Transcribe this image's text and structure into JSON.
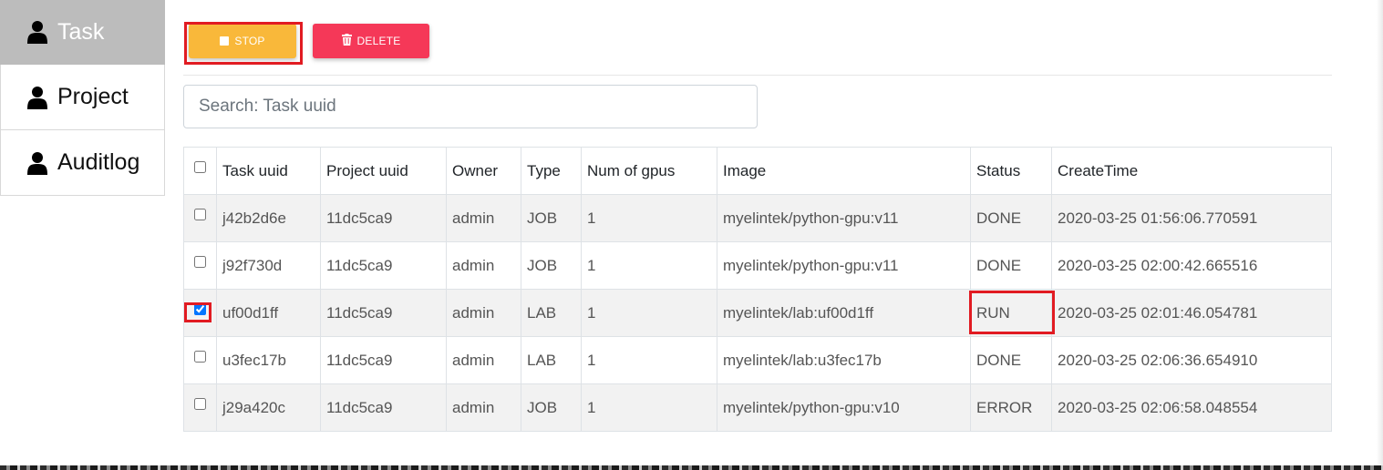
{
  "sidebar": {
    "items": [
      {
        "label": "Task",
        "icon": "user-icon",
        "active": true
      },
      {
        "label": "Project",
        "icon": "user-icon",
        "active": false
      },
      {
        "label": "Auditlog",
        "icon": "user-icon",
        "active": false
      }
    ]
  },
  "toolbar": {
    "stop_label": "STOP",
    "delete_label": "DELETE"
  },
  "search": {
    "placeholder": "Search: Task uuid",
    "value": ""
  },
  "table": {
    "headers": [
      "Task uuid",
      "Project uuid",
      "Owner",
      "Type",
      "Num of gpus",
      "Image",
      "Status",
      "CreateTime"
    ],
    "rows": [
      {
        "checked": false,
        "task_uuid": "j42b2d6e",
        "project_uuid": "11dc5ca9",
        "owner": "admin",
        "type": "JOB",
        "gpus": "1",
        "image": "myelintek/python-gpu:v11",
        "status": "DONE",
        "create_time": "2020-03-25 01:56:06.770591"
      },
      {
        "checked": false,
        "task_uuid": "j92f730d",
        "project_uuid": "11dc5ca9",
        "owner": "admin",
        "type": "JOB",
        "gpus": "1",
        "image": "myelintek/python-gpu:v11",
        "status": "DONE",
        "create_time": "2020-03-25 02:00:42.665516"
      },
      {
        "checked": true,
        "task_uuid": "uf00d1ff",
        "project_uuid": "11dc5ca9",
        "owner": "admin",
        "type": "LAB",
        "gpus": "1",
        "image": "myelintek/lab:uf00d1ff",
        "status": "RUN",
        "create_time": "2020-03-25 02:01:46.054781"
      },
      {
        "checked": false,
        "task_uuid": "u3fec17b",
        "project_uuid": "11dc5ca9",
        "owner": "admin",
        "type": "LAB",
        "gpus": "1",
        "image": "myelintek/lab:u3fec17b",
        "status": "DONE",
        "create_time": "2020-03-25 02:06:36.654910"
      },
      {
        "checked": false,
        "task_uuid": "j29a420c",
        "project_uuid": "11dc5ca9",
        "owner": "admin",
        "type": "JOB",
        "gpus": "1",
        "image": "myelintek/python-gpu:v10",
        "status": "ERROR",
        "create_time": "2020-03-25 02:06:58.048554"
      }
    ]
  },
  "colors": {
    "stop": "#f9b83a",
    "delete": "#f53858",
    "highlight": "#e11b22",
    "sidebar_active": "#bcbcbc"
  }
}
